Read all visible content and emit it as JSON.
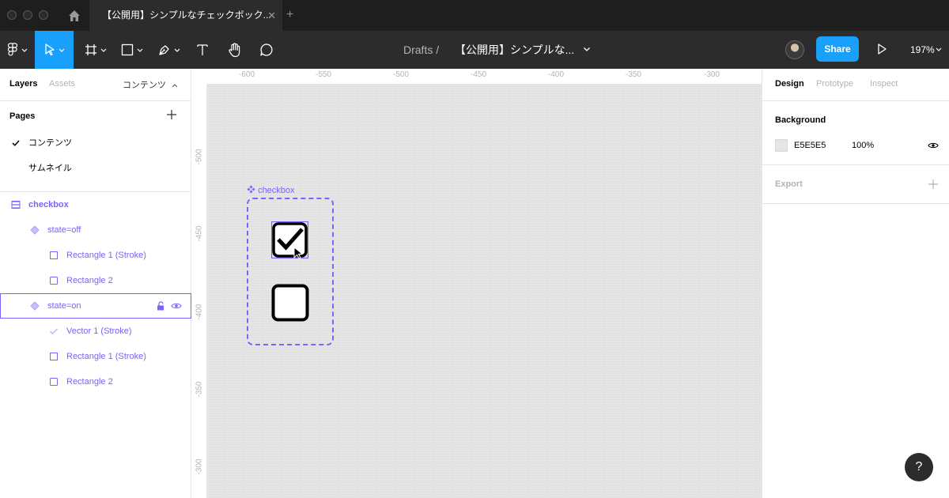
{
  "titlebar": {
    "tab_title": "【公開用】シンプルなチェックボック...",
    "tab_close": "✕",
    "tab_add": "+"
  },
  "toolbar": {
    "breadcrumb": "Drafts  /",
    "filename": "【公開用】シンプルな...",
    "share_label": "Share",
    "zoom": "197%"
  },
  "left_panel": {
    "tabs": {
      "layers": "Layers",
      "assets": "Assets"
    },
    "current_page": "コンテンツ",
    "pages_title": "Pages",
    "pages": [
      {
        "label": "コンテンツ",
        "active": true
      },
      {
        "label": "サムネイル",
        "active": false
      }
    ],
    "layers": [
      {
        "label": "checkbox",
        "kind": "component-set"
      },
      {
        "label": "state=off",
        "kind": "variant"
      },
      {
        "label": "Rectangle 1 (Stroke)",
        "kind": "shape"
      },
      {
        "label": "Rectangle 2",
        "kind": "shape"
      },
      {
        "label": "state=on",
        "kind": "variant",
        "selected": true
      },
      {
        "label": "Vector 1 (Stroke)",
        "kind": "vector"
      },
      {
        "label": "Rectangle 1 (Stroke)",
        "kind": "shape"
      },
      {
        "label": "Rectangle 2",
        "kind": "shape"
      }
    ]
  },
  "canvas": {
    "ruler_top": [
      "-600",
      "-550",
      "-500",
      "-450",
      "-400",
      "-350",
      "-300"
    ],
    "ruler_left": [
      "-500",
      "-450",
      "-400",
      "-350",
      "-300"
    ],
    "frame_label": "checkbox"
  },
  "right_panel": {
    "tabs": {
      "design": "Design",
      "prototype": "Prototype",
      "inspect": "Inspect"
    },
    "background_title": "Background",
    "background_hex": "E5E5E5",
    "background_opacity": "100%",
    "export_title": "Export",
    "help": "?"
  },
  "colors": {
    "accent": "#18a0fb",
    "component": "#7b61ff",
    "canvas_bg": "#e5e5e5",
    "dark_ui": "#2c2c2c"
  }
}
